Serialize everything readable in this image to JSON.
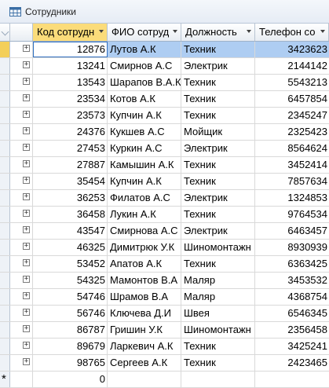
{
  "window": {
    "title": "Сотрудники"
  },
  "columns": [
    "Код сотрудн",
    "ФИО сотруд",
    "Должность",
    "Телефон со"
  ],
  "rows": [
    {
      "code": "12876",
      "name": "Лутов А.К",
      "position": "Техник",
      "phone": "3423623"
    },
    {
      "code": "13241",
      "name": "Смирнов А.С",
      "position": "Электрик",
      "phone": "2144142"
    },
    {
      "code": "13543",
      "name": "Шарапов В.А.К",
      "position": "Техник",
      "phone": "5543213"
    },
    {
      "code": "23534",
      "name": "Котов А.К",
      "position": "Техник",
      "phone": "6457854"
    },
    {
      "code": "23573",
      "name": "Купчин А.К",
      "position": "Техник",
      "phone": "2345247"
    },
    {
      "code": "24376",
      "name": "Кукшев А.С",
      "position": "Мойщик",
      "phone": "2325423"
    },
    {
      "code": "27453",
      "name": "Куркин А.С",
      "position": "Электрик",
      "phone": "8564624"
    },
    {
      "code": "27887",
      "name": "Камышин А.К",
      "position": "Техник",
      "phone": "3452414"
    },
    {
      "code": "35454",
      "name": "Купчин А.К",
      "position": "Техник",
      "phone": "7857634"
    },
    {
      "code": "36253",
      "name": "Филатов А.С",
      "position": "Электрик",
      "phone": "1324853"
    },
    {
      "code": "36458",
      "name": "Лукин А.К",
      "position": "Техник",
      "phone": "9764534"
    },
    {
      "code": "43547",
      "name": "Смирнова А.С",
      "position": "Электрик",
      "phone": "6463457"
    },
    {
      "code": "46325",
      "name": "Димитрюк У.К",
      "position": "Шиномонтажн",
      "phone": "8930939"
    },
    {
      "code": "53452",
      "name": "Апатов А.К",
      "position": "Техник",
      "phone": "6363425"
    },
    {
      "code": "54325",
      "name": "Мамонтов В.А",
      "position": "Маляр",
      "phone": "3453532"
    },
    {
      "code": "54746",
      "name": "Шрамов В.А",
      "position": "Маляр",
      "phone": "4368754"
    },
    {
      "code": "56746",
      "name": "Ключева Д.И",
      "position": "Швея",
      "phone": "6546345"
    },
    {
      "code": "86787",
      "name": "Гришин У.К",
      "position": "Шиномонтажн",
      "phone": "2356458"
    },
    {
      "code": "89679",
      "name": "Ларкевич А.К",
      "position": "Техник",
      "phone": "3425241"
    },
    {
      "code": "98765",
      "name": "Сергеев А.К",
      "position": "Техник",
      "phone": "2423465"
    }
  ],
  "new_row": {
    "marker": "*",
    "code": "0"
  }
}
